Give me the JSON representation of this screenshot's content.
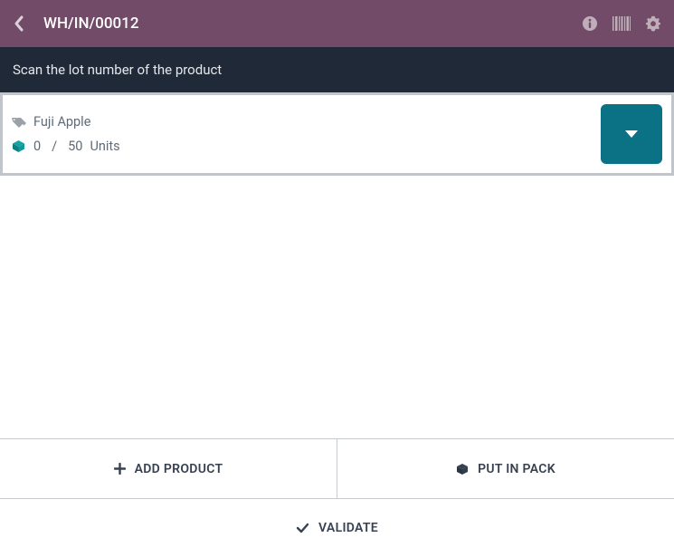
{
  "header": {
    "title": "WH/IN/00012"
  },
  "instruction": "Scan the lot number of the product",
  "product": {
    "name": "Fuji Apple",
    "qty_done": "0",
    "qty_separator": "/",
    "qty_demand": "50",
    "uom": "Units"
  },
  "buttons": {
    "add_product": "ADD PRODUCT",
    "put_in_pack": "PUT IN PACK",
    "validate": "VALIDATE"
  }
}
